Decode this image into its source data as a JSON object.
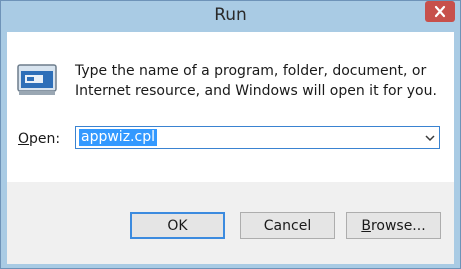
{
  "window": {
    "title": "Run"
  },
  "message": {
    "line1": "Type the name of a program, folder, document, or",
    "line2": "Internet resource, and Windows will open it for you."
  },
  "open_field": {
    "label_accel": "O",
    "label_rest": "pen:",
    "value": "appwiz.cpl"
  },
  "buttons": {
    "ok": "OK",
    "cancel": "Cancel",
    "browse_accel": "B",
    "browse_rest": "rowse..."
  },
  "colors": {
    "frame": "#a9cbe4",
    "close_button": "#c7504b",
    "selection": "#3399ff",
    "focus_border": "#3c8bdf"
  },
  "icons": {
    "run": "run-program-icon",
    "close": "close-icon",
    "dropdown": "chevron-down-icon"
  }
}
